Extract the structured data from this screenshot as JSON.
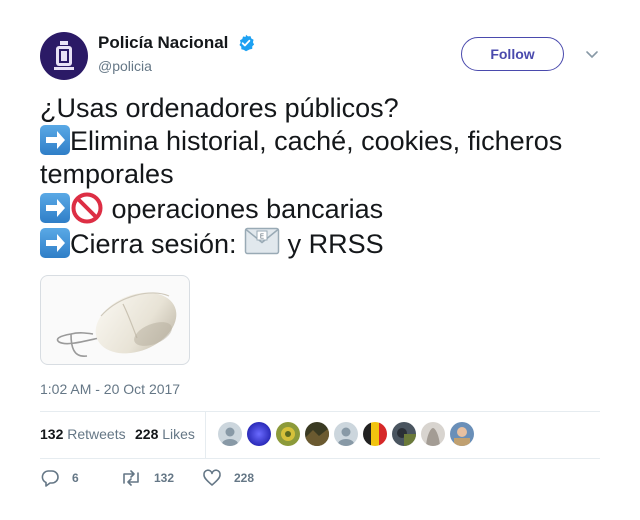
{
  "account": {
    "display_name": "Policía Nacional",
    "handle": "@policia",
    "verified": true,
    "follow_label": "Follow"
  },
  "tweet": {
    "line1": "¿Usas ordenadores públicos?",
    "line2": "Elimina historial, caché, cookies, ficheros",
    "line3": "temporales",
    "line4": " operaciones bancarias",
    "line5_a": "Cierra sesión: ",
    "line5_b": " y RRSS",
    "timestamp": "1:02 AM - 20 Oct 2017"
  },
  "stats": {
    "retweets_count": "132",
    "retweets_label": "Retweets",
    "likes_count": "228",
    "likes_label": "Likes"
  },
  "actions": {
    "reply_count": "6",
    "retweet_count": "132",
    "like_count": "228"
  },
  "icons": [
    "verified-badge-icon",
    "chevron-down-icon",
    "right-arrow-emoji-icon",
    "no-entry-emoji-icon",
    "envelope-emoji-icon",
    "reply-icon",
    "retweet-icon",
    "heart-icon"
  ],
  "colors": {
    "accent": "#4a4aad",
    "verified": "#1da1f2",
    "muted_text": "#657786"
  }
}
